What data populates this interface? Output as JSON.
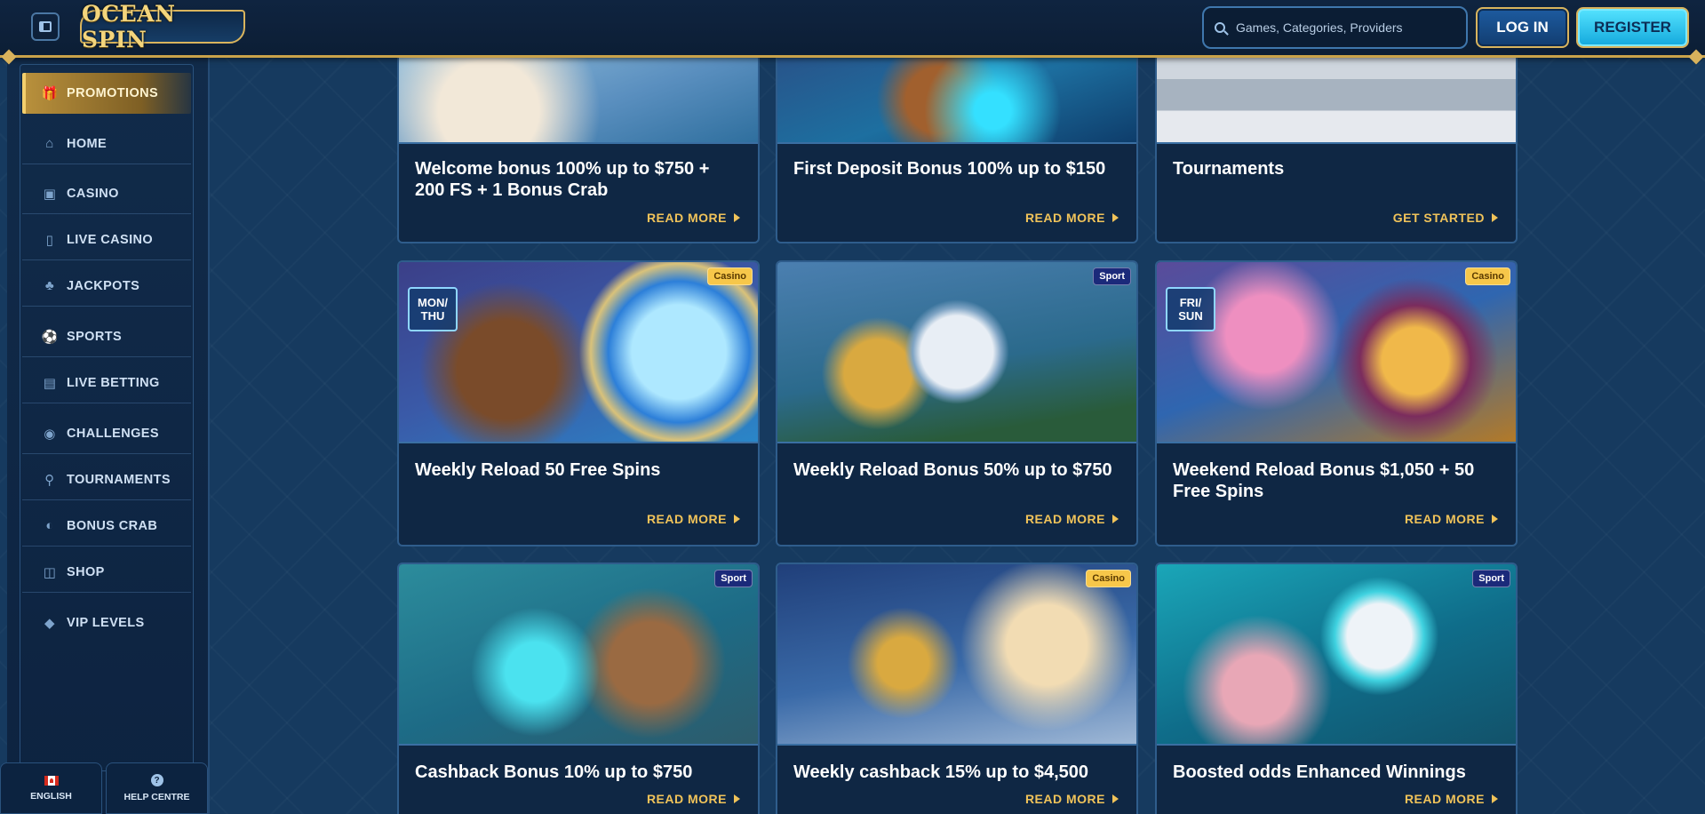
{
  "header": {
    "logo_text": "OCEAN SPIN",
    "search_placeholder": "Games, Categories, Providers",
    "login_label": "LOG IN",
    "register_label": "REGISTER"
  },
  "sidebar": {
    "items": [
      {
        "label": "PROMOTIONS",
        "icon": "gift-icon"
      },
      {
        "label": "HOME",
        "icon": "home-icon"
      },
      {
        "label": "CASINO",
        "icon": "slot-machine-icon"
      },
      {
        "label": "LIVE CASINO",
        "icon": "mobile-icon"
      },
      {
        "label": "JACKPOTS",
        "icon": "clover-icon"
      },
      {
        "label": "SPORTS",
        "icon": "ball-icon"
      },
      {
        "label": "LIVE BETTING",
        "icon": "live-icon"
      },
      {
        "label": "CHALLENGES",
        "icon": "medal-icon"
      },
      {
        "label": "TOURNAMENTS",
        "icon": "trophy-icon"
      },
      {
        "label": "BONUS CRAB",
        "icon": "crab-icon"
      },
      {
        "label": "SHOP",
        "icon": "basket-icon"
      },
      {
        "label": "VIP LEVELS",
        "icon": "diamond-icon"
      }
    ],
    "footer": {
      "language_label": "ENGLISH",
      "help_label": "HELP CENTRE",
      "help_glyph": "?"
    }
  },
  "promotions": [
    {
      "title": "Welcome bonus 100% up to $750 + 200 FS + 1 Bonus Crab",
      "link": "READ MORE",
      "badge": "",
      "day_tag": ""
    },
    {
      "title": "First Deposit Bonus 100% up to $150",
      "link": "READ MORE",
      "badge": "",
      "day_tag": ""
    },
    {
      "title": "Tournaments",
      "link": "GET STARTED",
      "badge": "",
      "day_tag": ""
    },
    {
      "title": "Weekly Reload 50 Free Spins",
      "link": "READ MORE",
      "badge": "Casino",
      "day_tag": "MON/ THU"
    },
    {
      "title": "Weekly Reload Bonus 50% up to $750",
      "link": "READ MORE",
      "badge": "Sport",
      "day_tag": ""
    },
    {
      "title": "Weekend Reload Bonus $1,050 + 50 Free Spins",
      "link": "READ MORE",
      "badge": "Casino",
      "day_tag": "FRI/ SUN"
    },
    {
      "title": "Cashback Bonus 10% up to $750",
      "link": "READ MORE",
      "badge": "Sport",
      "day_tag": ""
    },
    {
      "title": "Weekly cashback 15% up to $4,500",
      "link": "READ MORE",
      "badge": "Casino",
      "day_tag": ""
    },
    {
      "title": "Boosted odds Enhanced Winnings",
      "link": "READ MORE",
      "badge": "Sport",
      "day_tag": ""
    }
  ]
}
